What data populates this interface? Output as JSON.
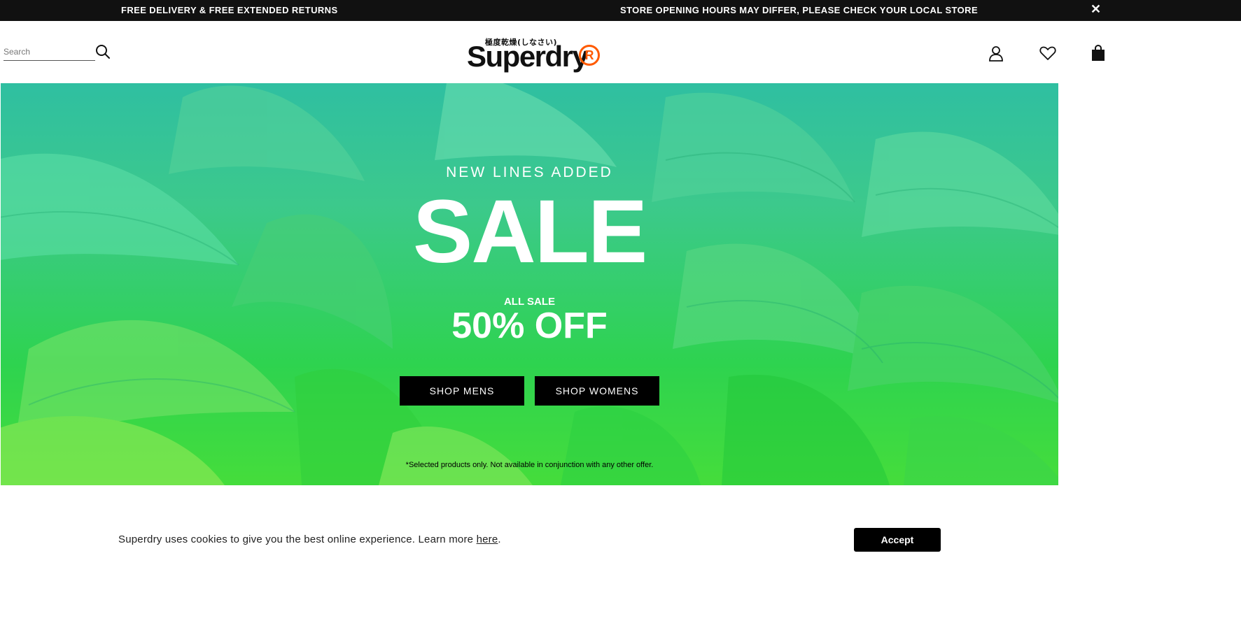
{
  "announcement": {
    "left": "FREE DELIVERY & FREE EXTENDED RETURNS",
    "right": "STORE OPENING HOURS MAY DIFFER, PLEASE CHECK YOUR LOCAL STORE",
    "close": "✕"
  },
  "header": {
    "search_placeholder": "Search",
    "logo_kanji": "極度乾燥(しなさい)",
    "logo_text": "Superdry",
    "logo_mark": "R",
    "logo_mark_color": "#ff5a00",
    "icons": [
      "search-icon",
      "account-icon",
      "wishlist-icon",
      "bag-icon"
    ]
  },
  "hero": {
    "eyebrow": "NEW LINES ADDED",
    "headline": "SALE",
    "subline": "ALL SALE",
    "discount": "50% OFF",
    "buttons": {
      "mens": "SHOP MENS",
      "womens": "SHOP WOMENS"
    },
    "disclaimer": "*Selected products only. Not available in conjunction with any other offer."
  },
  "cookie": {
    "text": "Superdry uses cookies to give you the best online experience. Learn more ",
    "link": "here",
    "suffix": ".",
    "accept": "Accept"
  }
}
